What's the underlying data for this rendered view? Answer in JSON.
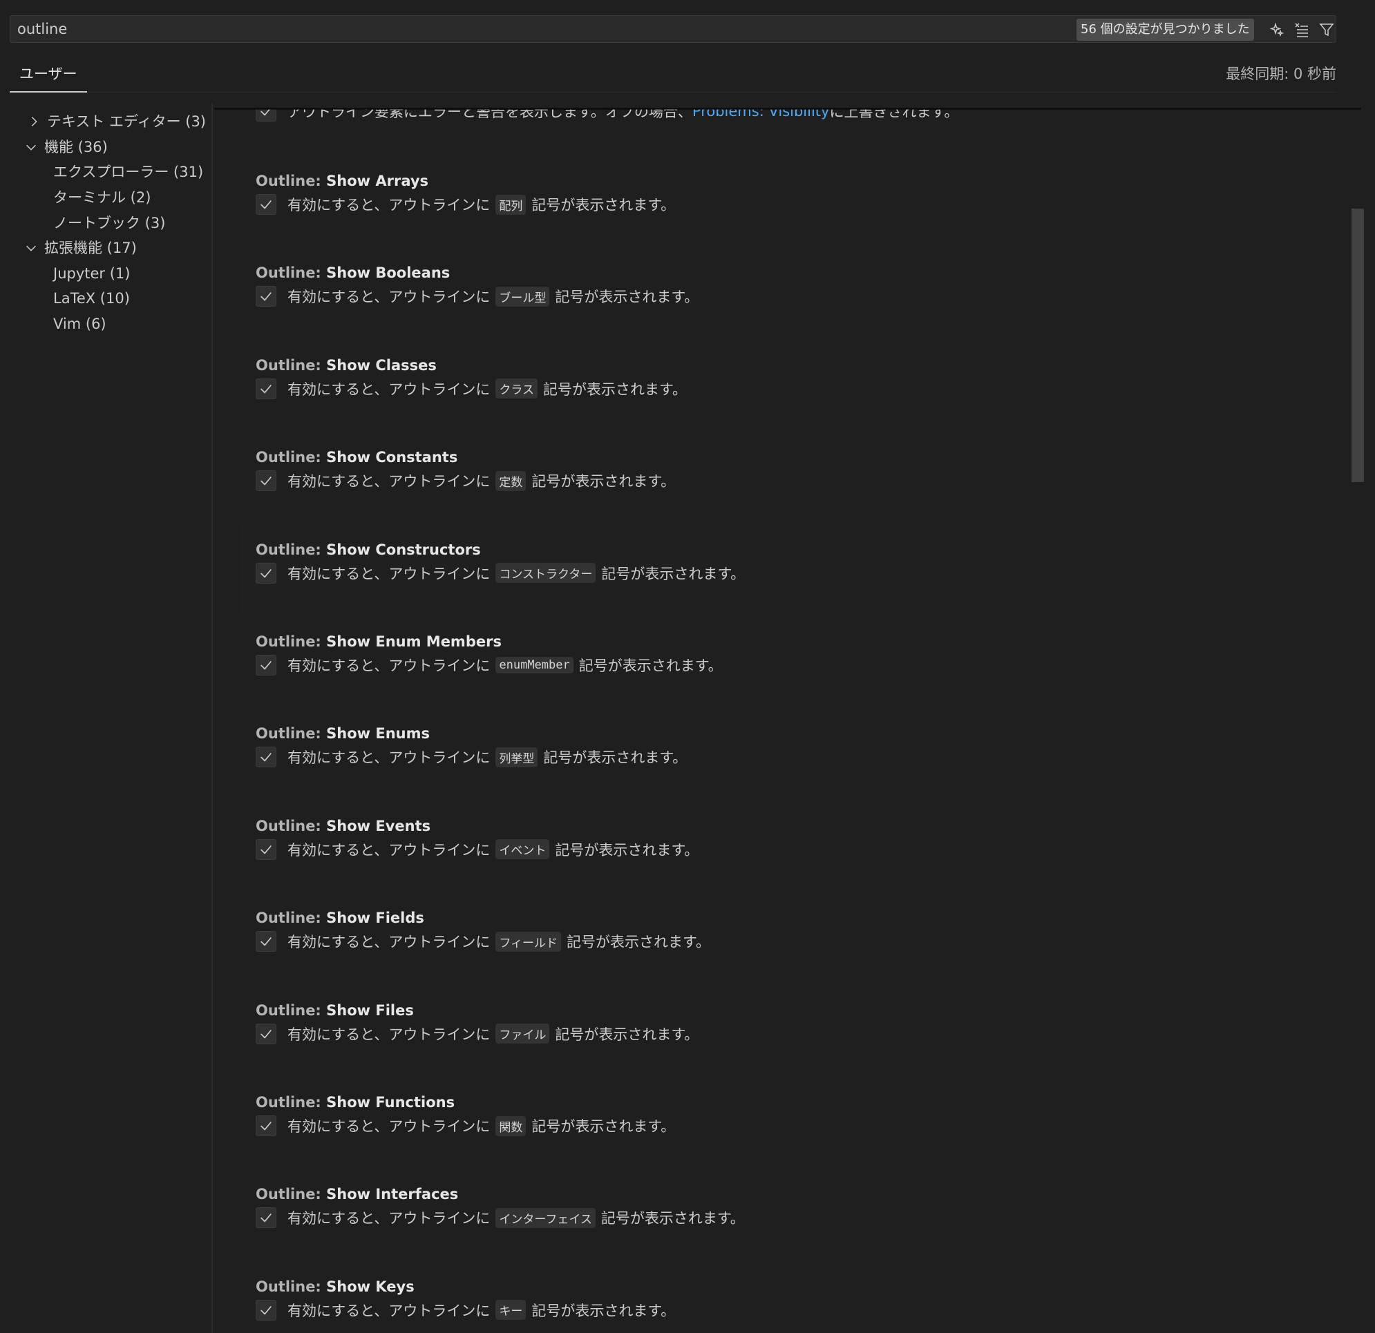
{
  "search": {
    "value": "outline",
    "result_count": "56 個の設定が見つかりました",
    "icons": [
      "sparkle-icon",
      "clear-filter-icon",
      "filter-icon"
    ]
  },
  "tabs": {
    "user_label": "ユーザー",
    "sync_status": "最終同期: 0 秒前"
  },
  "sidebar": {
    "items": [
      {
        "label": "テキスト エディター (3)",
        "chevron": "right"
      },
      {
        "label": "機能 (36)",
        "chevron": "down"
      },
      {
        "label": "エクスプローラー (31)",
        "chevron": ""
      },
      {
        "label": "ターミナル (2)",
        "chevron": ""
      },
      {
        "label": "ノートブック (3)",
        "chevron": ""
      },
      {
        "label": "拡張機能 (17)",
        "chevron": "down"
      },
      {
        "label": "Jupyter (1)",
        "chevron": ""
      },
      {
        "label": "LaTeX (10)",
        "chevron": ""
      },
      {
        "label": "Vim (6)",
        "chevron": ""
      }
    ]
  },
  "partial_setting": {
    "desc_before": "アウトライン要素にエラーと警告を表示します。オフの場合、",
    "link": "Problems: Visibility",
    "desc_after": " に上書きされます。"
  },
  "settings": [
    {
      "category": "Outline: ",
      "name": "Show Arrays",
      "desc_prefix": "有効にすると、アウトラインに",
      "code": "配列",
      "desc_suffix": "記号が表示されます。"
    },
    {
      "category": "Outline: ",
      "name": "Show Booleans",
      "desc_prefix": "有効にすると、アウトラインに",
      "code": "ブール型",
      "desc_suffix": "記号が表示されます。"
    },
    {
      "category": "Outline: ",
      "name": "Show Classes",
      "desc_prefix": "有効にすると、アウトラインに",
      "code": "クラス",
      "desc_suffix": "記号が表示されます。"
    },
    {
      "category": "Outline: ",
      "name": "Show Constants",
      "desc_prefix": "有効にすると、アウトラインに",
      "code": "定数",
      "desc_suffix": "記号が表示されます。"
    },
    {
      "category": "Outline: ",
      "name": "Show Constructors",
      "desc_prefix": "有効にすると、アウトラインに",
      "code": "コンストラクター",
      "desc_suffix": "記号が表示されます。"
    },
    {
      "category": "Outline: ",
      "name": "Show Enum Members",
      "desc_prefix": "有効にすると、アウトラインに",
      "code": "enumMember",
      "desc_suffix": "記号が表示されます。"
    },
    {
      "category": "Outline: ",
      "name": "Show Enums",
      "desc_prefix": "有効にすると、アウトラインに",
      "code": "列挙型",
      "desc_suffix": "記号が表示されます。"
    },
    {
      "category": "Outline: ",
      "name": "Show Events",
      "desc_prefix": "有効にすると、アウトラインに",
      "code": "イベント",
      "desc_suffix": "記号が表示されます。"
    },
    {
      "category": "Outline: ",
      "name": "Show Fields",
      "desc_prefix": "有効にすると、アウトラインに",
      "code": "フィールド",
      "desc_suffix": "記号が表示されます。"
    },
    {
      "category": "Outline: ",
      "name": "Show Files",
      "desc_prefix": "有効にすると、アウトラインに",
      "code": "ファイル",
      "desc_suffix": "記号が表示されます。"
    },
    {
      "category": "Outline: ",
      "name": "Show Functions",
      "desc_prefix": "有効にすると、アウトラインに",
      "code": "関数",
      "desc_suffix": "記号が表示されます。"
    },
    {
      "category": "Outline: ",
      "name": "Show Interfaces",
      "desc_prefix": "有効にすると、アウトラインに",
      "code": "インターフェイス",
      "desc_suffix": "記号が表示されます。"
    },
    {
      "category": "Outline: ",
      "name": "Show Keys",
      "desc_prefix": "有効にすると、アウトラインに",
      "code": "キー",
      "desc_suffix": "記号が表示されます。"
    }
  ],
  "colors": {
    "background": "#1f1f1f",
    "link": "#4daafc",
    "badge": "#4d4d4d",
    "text": "#cccccc"
  }
}
